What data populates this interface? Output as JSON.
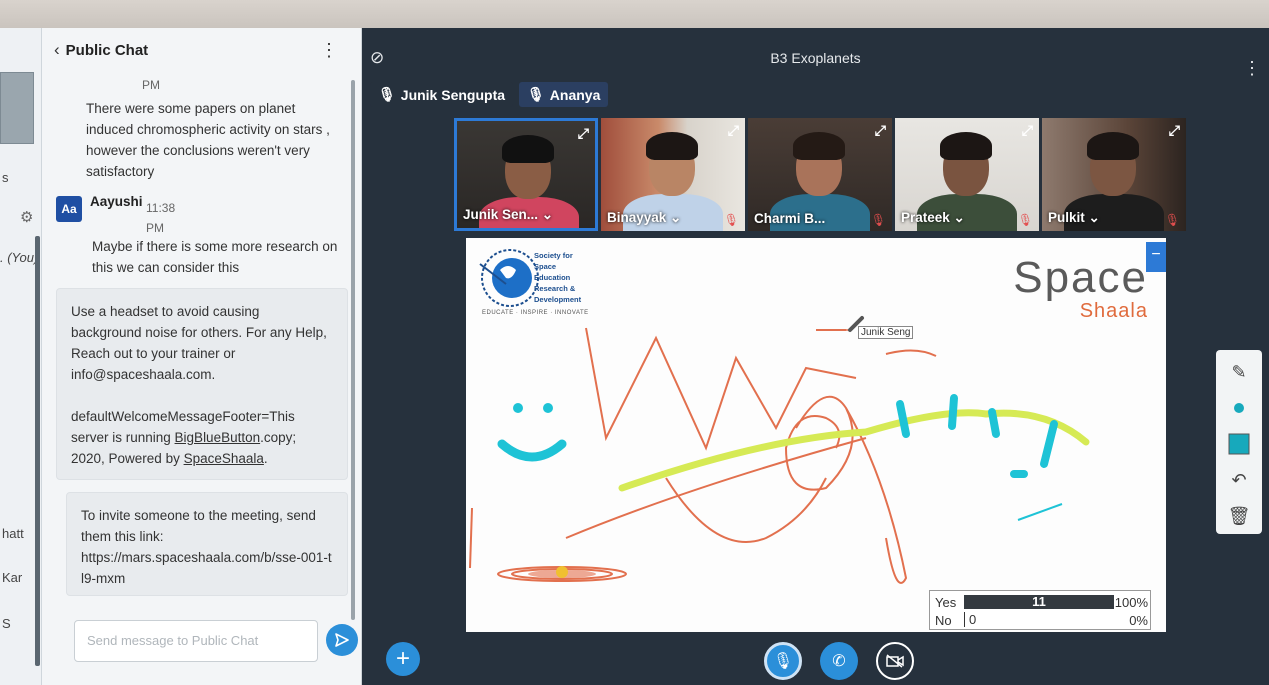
{
  "chat": {
    "back_label": "Public Chat",
    "msg_prev_time": "PM",
    "msg_prev_text": "There were some papers on planet induced chromospheric activity on stars , however the conclusions weren't very satisfactory",
    "msg2_avatar": "Aa",
    "msg2_name": "Aayushi",
    "msg2_time": "11:38",
    "msg2_time_suffix": "PM",
    "msg2_text": "Maybe if there is some more research on this we can consider this",
    "welcome_text_1": "Use a headset to avoid causing background noise for others. For any Help, Reach out to your trainer or info@spaceshaala.com.",
    "welcome_footer_a": "defaultWelcomeMessageFooter=This server is running ",
    "welcome_footer_link1": "BigBlueButton",
    "welcome_footer_b": ".copy; 2020, Powered by ",
    "welcome_footer_link2": "SpaceShaala",
    "welcome_footer_c": ".",
    "invite_text": "To invite someone to the meeting, send them this link:",
    "invite_link": "https://mars.spaceshaala.com/b/sse-001-tl9-mxm",
    "input_placeholder": "Send message to Public Chat"
  },
  "userlist": {
    "fragments": [
      "s",
      ". (You)",
      "hatt",
      "Kar",
      "S"
    ]
  },
  "meeting": {
    "title": "B3 Exoplanets",
    "talking": [
      "Junik Sengupta",
      "Ananya"
    ]
  },
  "videos": [
    {
      "name": "Junik Sen... ⌄",
      "active": true,
      "muted": false
    },
    {
      "name": "Binayyak ⌄",
      "active": false,
      "muted": true
    },
    {
      "name": "Charmi B...",
      "active": false,
      "muted": true
    },
    {
      "name": "Prateek ⌄",
      "active": false,
      "muted": true
    },
    {
      "name": "Pulkit ⌄",
      "active": false,
      "muted": true
    }
  ],
  "whiteboard": {
    "logo_left_lines": [
      "Society for",
      "Space",
      "Education",
      "Research &",
      "Development"
    ],
    "logo_left_tagline": "EDUCATE · INSPIRE · INNOVATE",
    "logo_right_main": "Space",
    "logo_right_sub": "Shaala",
    "cursor_label": "Junik Seng",
    "minimize": "−"
  },
  "poll": {
    "rows": [
      {
        "label": "Yes",
        "count": "11",
        "percent": "100%",
        "fraction": 1.0
      },
      {
        "label": "No",
        "count": "0",
        "percent": "0%",
        "fraction": 0.0
      }
    ]
  },
  "colors": {
    "accent": "#2b8fd9",
    "active_border": "#2d7ad6",
    "brand_orange": "#e06b3d",
    "poll_bar": "#343a40"
  }
}
